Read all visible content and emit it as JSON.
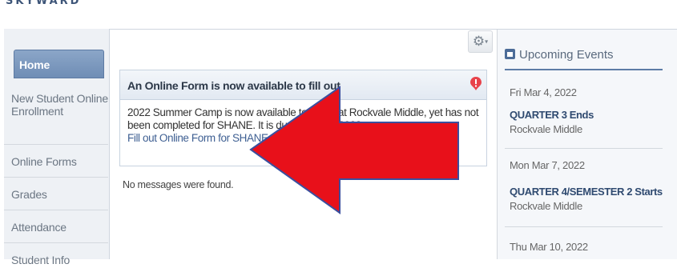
{
  "brand": {
    "text": "SKYWARD"
  },
  "nav": {
    "items": [
      {
        "label": "Home"
      },
      {
        "label": "New Student Online Enrollment"
      },
      {
        "label": "Online Forms"
      },
      {
        "label": "Grades"
      },
      {
        "label": "Attendance"
      },
      {
        "label": "Student Info"
      }
    ]
  },
  "alert": {
    "title": "An Online Form is now available to fill out",
    "message": "2022 Summer Camp is now available to fill out at Rockvale Middle, yet has not been completed for SHANE.  It is due by 04-02-2022.",
    "link": "Fill out Online Form for SHANE"
  },
  "messages": {
    "empty": "No messages were found."
  },
  "events": {
    "title": "Upcoming Events",
    "items": [
      {
        "date": "Fri Mar 4, 2022",
        "title": "QUARTER 3 Ends",
        "location": "Rockvale Middle"
      },
      {
        "date": "Mon Mar 7, 2022",
        "title": "QUARTER 4/SEMESTER 2 Starts",
        "location": "Rockvale Middle"
      },
      {
        "date": "Thu Mar 10, 2022",
        "title": "",
        "location": ""
      }
    ]
  },
  "colors": {
    "accent": "#6f8db5",
    "arrow": "#e8101a",
    "link": "#3e5f92",
    "alert_icon": "#e8434b"
  }
}
